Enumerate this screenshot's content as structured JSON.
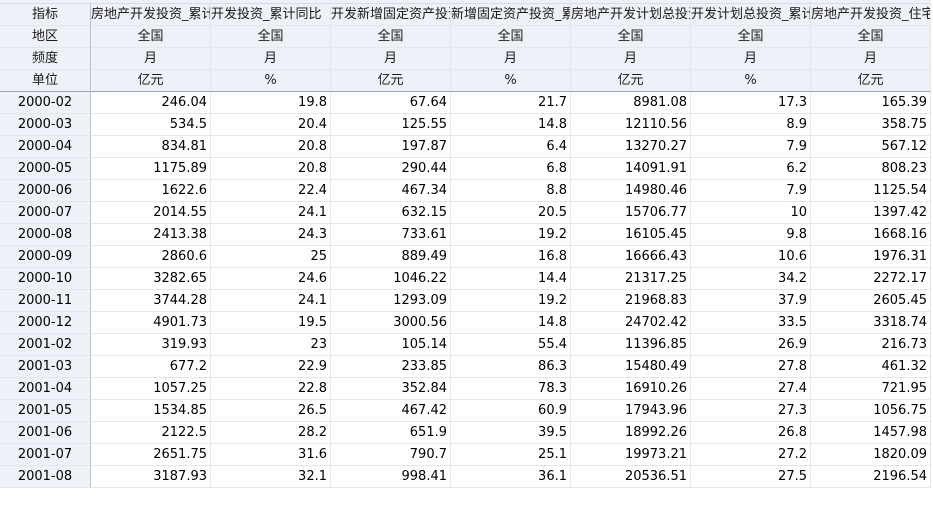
{
  "header_labels": {
    "indicator": "指标",
    "region": "地区",
    "frequency": "频度",
    "unit": "单位"
  },
  "columns": [
    {
      "name": "房地产开发投资_累计值",
      "region": "全国",
      "frequency": "月",
      "unit": "亿元"
    },
    {
      "name": "开发投资_累计同比",
      "region": "全国",
      "frequency": "月",
      "unit": "%"
    },
    {
      "name": "开发新增固定资产投资",
      "region": "全国",
      "frequency": "月",
      "unit": "亿元"
    },
    {
      "name": "新增固定资产投资_累计同比",
      "region": "全国",
      "frequency": "月",
      "unit": "%"
    },
    {
      "name": "房地产开发计划总投资",
      "region": "全国",
      "frequency": "月",
      "unit": "亿元"
    },
    {
      "name": "开发计划总投资_累计同比",
      "region": "全国",
      "frequency": "月",
      "unit": "%"
    },
    {
      "name": "房地产开发投资_住宅_累计值",
      "region": "全国",
      "frequency": "月",
      "unit": "亿元"
    }
  ],
  "rows": [
    {
      "date": "2000-02",
      "values": [
        "246.04",
        "19.8",
        "67.64",
        "21.7",
        "8981.08",
        "17.3",
        "165.39"
      ]
    },
    {
      "date": "2000-03",
      "values": [
        "534.5",
        "20.4",
        "125.55",
        "14.8",
        "12110.56",
        "8.9",
        "358.75"
      ]
    },
    {
      "date": "2000-04",
      "values": [
        "834.81",
        "20.8",
        "197.87",
        "6.4",
        "13270.27",
        "7.9",
        "567.12"
      ]
    },
    {
      "date": "2000-05",
      "values": [
        "1175.89",
        "20.8",
        "290.44",
        "6.8",
        "14091.91",
        "6.2",
        "808.23"
      ]
    },
    {
      "date": "2000-06",
      "values": [
        "1622.6",
        "22.4",
        "467.34",
        "8.8",
        "14980.46",
        "7.9",
        "1125.54"
      ]
    },
    {
      "date": "2000-07",
      "values": [
        "2014.55",
        "24.1",
        "632.15",
        "20.5",
        "15706.77",
        "10",
        "1397.42"
      ]
    },
    {
      "date": "2000-08",
      "values": [
        "2413.38",
        "24.3",
        "733.61",
        "19.2",
        "16105.45",
        "9.8",
        "1668.16"
      ]
    },
    {
      "date": "2000-09",
      "values": [
        "2860.6",
        "25",
        "889.49",
        "16.8",
        "16666.43",
        "10.6",
        "1976.31"
      ]
    },
    {
      "date": "2000-10",
      "values": [
        "3282.65",
        "24.6",
        "1046.22",
        "14.4",
        "21317.25",
        "34.2",
        "2272.17"
      ]
    },
    {
      "date": "2000-11",
      "values": [
        "3744.28",
        "24.1",
        "1293.09",
        "19.2",
        "21968.83",
        "37.9",
        "2605.45"
      ]
    },
    {
      "date": "2000-12",
      "values": [
        "4901.73",
        "19.5",
        "3000.56",
        "14.8",
        "24702.42",
        "33.5",
        "3318.74"
      ]
    },
    {
      "date": "2001-02",
      "values": [
        "319.93",
        "23",
        "105.14",
        "55.4",
        "11396.85",
        "26.9",
        "216.73"
      ]
    },
    {
      "date": "2001-03",
      "values": [
        "677.2",
        "22.9",
        "233.85",
        "86.3",
        "15480.49",
        "27.8",
        "461.32"
      ]
    },
    {
      "date": "2001-04",
      "values": [
        "1057.25",
        "22.8",
        "352.84",
        "78.3",
        "16910.26",
        "27.4",
        "721.95"
      ]
    },
    {
      "date": "2001-05",
      "values": [
        "1534.85",
        "26.5",
        "467.42",
        "60.9",
        "17943.96",
        "27.3",
        "1056.75"
      ]
    },
    {
      "date": "2001-06",
      "values": [
        "2122.5",
        "28.2",
        "651.9",
        "39.5",
        "18992.26",
        "26.8",
        "1457.98"
      ]
    },
    {
      "date": "2001-07",
      "values": [
        "2651.75",
        "31.6",
        "790.7",
        "25.1",
        "19973.21",
        "27.2",
        "1820.09"
      ]
    },
    {
      "date": "2001-08",
      "values": [
        "3187.93",
        "32.1",
        "998.41",
        "36.1",
        "20536.51",
        "27.5",
        "2196.54"
      ]
    }
  ]
}
